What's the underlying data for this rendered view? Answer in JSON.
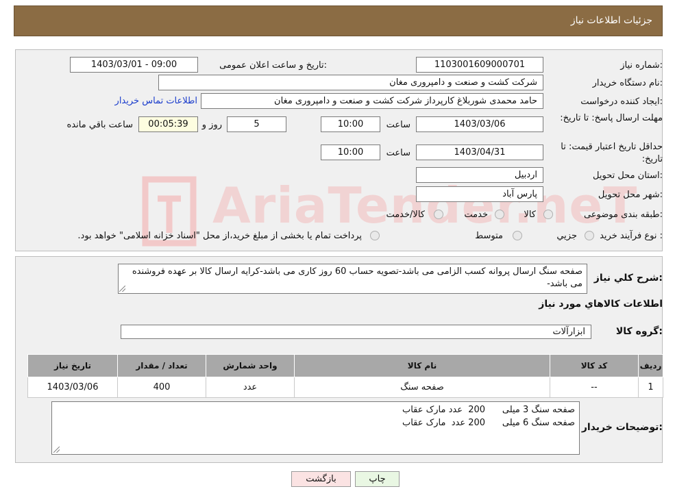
{
  "header": {
    "title": "جزئیات اطلاعات نیاز"
  },
  "labels": {
    "need_number": "شماره نیاز:",
    "announce_datetime": "تاریخ و ساعت اعلان عمومی:",
    "buyer_org": "نام دستگاه خریدار:",
    "requester": "ایجاد کننده درخواست:",
    "contact_link": "اطلاعات تماس خریدار",
    "reply_deadline": "مهلت ارسال پاسخ: تا تاریخ:",
    "time": "ساعت",
    "days_and": "روز و",
    "remaining": "ساعت باقي مانده",
    "price_validity": "حداقل تاریخ اعتبار قیمت: تا تاریخ:",
    "province": "استان محل تحویل:",
    "city": "شهر محل تحویل:",
    "category": "طبقه بندی موضوعی:",
    "process_type": "نوع فرآیند خرید :",
    "description": "شرح کلي نياز:",
    "goods_info": "اطلاعات کالاهاي مورد نياز",
    "goods_group": "گروه کالا:",
    "buyer_notes": "توضیحات خریدار:"
  },
  "fields": {
    "need_number": "1103001609000701",
    "announce_datetime": "1403/03/01 - 09:00",
    "buyer_org": "شرکت کشت و صنعت و دامپروری مغان",
    "requester": "حامد محمدی شوربلاغ کارپرداز شرکت کشت و صنعت و دامپروری مغان",
    "reply_date": "1403/03/06",
    "reply_time": "10:00",
    "days": "5",
    "remaining_time": "00:05:39",
    "validity_date": "1403/04/31",
    "validity_time": "10:00",
    "province": "اردبیل",
    "city": "پارس آباد",
    "goods_group": "ابزارآلات"
  },
  "category_options": [
    "کالا",
    "خدمت",
    "کالا/خدمت"
  ],
  "process_options": [
    "جزیي",
    "متوسط"
  ],
  "process_note": "پرداخت تمام یا بخشی از مبلغ خرید،از محل \"اسناد خزانه اسلامی\" خواهد بود.",
  "description_text": "صفحه سنگ ارسال پروانه کسب الزامی می باشد-تصویه حساب 60 روز کاری می باشد-کرایه ارسال کالا بر عهده فروشنده می باشد-",
  "table": {
    "headers": [
      "ردیف",
      "کد کالا",
      "نام کالا",
      "واحد شمارش",
      "تعداد / مقدار",
      "تاریخ نیاز"
    ],
    "rows": [
      [
        "1",
        "--",
        "صفحه سنگ",
        "عدد",
        "400",
        "1403/03/06"
      ]
    ]
  },
  "buyer_notes_text": "صفحه سنگ 3 میلی      200  عدد مارک عقاب\nصفحه سنگ 6 میلی      200 عدد  مارک عقاب",
  "buttons": {
    "print": "چاپ",
    "back": "بازگشت"
  },
  "watermark": "AriaTender.neT",
  "colors": {
    "header_bg": "#8b6c44",
    "panel_bg": "#f0f0f0",
    "back_button_bg": "#fbe3e3",
    "print_button_bg": "#e9f7e3"
  }
}
